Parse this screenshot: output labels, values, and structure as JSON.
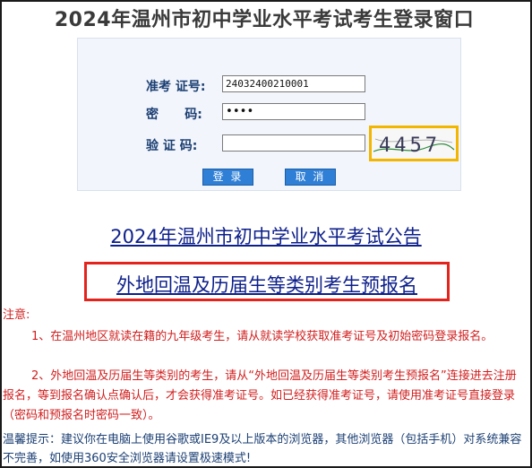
{
  "page_title": "2024年温州市初中学业水平考试考生登录窗口",
  "login": {
    "exam_no_label": "准考 证号:",
    "exam_no_value": "24032400210001",
    "password_label": "密      码:",
    "password_value": "••••",
    "captcha_label": "验 证 码:",
    "captcha_value": "",
    "captcha_text": "4457",
    "login_button": "登 录",
    "cancel_button": "取 消"
  },
  "links": {
    "notice": "2024年温州市初中学业水平考试公告",
    "prereg": "外地回温及历届生等类别考生预报名"
  },
  "notes": {
    "heading": "注意:",
    "item1": "1、在温州地区就读在籍的九年级考生，请从就读学校获取准考证号及初始密码登录报名。",
    "item2": "2、外地回温及历届生等类别的考生，请从“外地回温及历届生等类别考生预报名”连接进去注册报名，等到报名确认点确认后，才会获得准考证号。如已经获得准考证号，请使用准考证号直接登录（密码和预报名时密码一致）。"
  },
  "tip": "温馨提示：建议你在电脑上使用谷歌或IE9及以上版本的浏览器，其他浏览器（包括手机）对系统兼容不完善，如使用360安全浏览器请设置极速模式!",
  "colors": {
    "title": "#3a3a3a",
    "label": "#1b3f73",
    "button": "#2f7fd6",
    "link": "#0d1f8a",
    "notice_red": "#d11e1e",
    "captcha_border": "#f2b500",
    "prereg_border": "#e5231d"
  }
}
